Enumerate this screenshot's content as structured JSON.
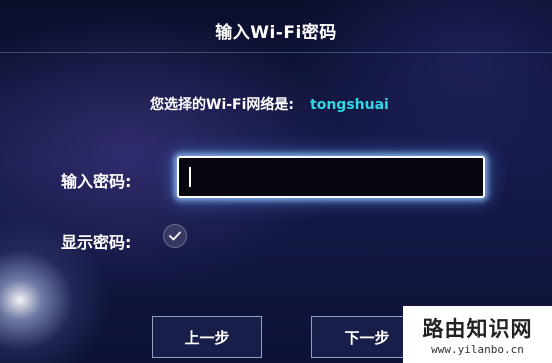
{
  "dialog": {
    "title": "输入Wi-Fi密码",
    "network_prompt": "您选择的Wi-Fi网络是:",
    "network_ssid": "tongshuai",
    "password_label": "输入密码:",
    "password_value": "",
    "show_password_label": "显示密码:",
    "show_password_checked": true
  },
  "buttons": {
    "prev_label": "上一步",
    "next_label": "下一步"
  },
  "watermark": {
    "title": "路由知识网",
    "url": "www.yilanbo.cn"
  },
  "colors": {
    "ssid": "#2fd6e6",
    "background": "#0b1030",
    "input_glow": "#96c8ff"
  }
}
